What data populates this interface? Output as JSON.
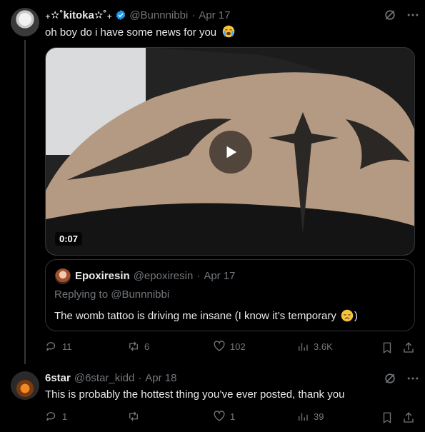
{
  "tweet1": {
    "display_name": "₊✫˚kitoka✫˚₊",
    "handle": "@Bunnnibbi",
    "separator": "·",
    "date": "Apr 17",
    "text": "oh boy do i have some news for you",
    "video": {
      "duration": "0:07"
    },
    "quote": {
      "display_name": "Epoxiresin",
      "handle": "@epoxiresin",
      "separator": "·",
      "date": "Apr 17",
      "replying_prefix": "Replying to",
      "replying_handle": "@Bunnnibbi",
      "text_before": "The womb tattoo is driving me insane (I know it’s temporary",
      "text_after": ")"
    },
    "stats": {
      "replies": "11",
      "reposts": "6",
      "likes": "102",
      "views": "3.6K"
    }
  },
  "tweet2": {
    "display_name": "6star",
    "handle": "@6star_kidd",
    "separator": "·",
    "date": "Apr 18",
    "text": "This is probably the hottest thing you’ve ever posted, thank you",
    "stats": {
      "replies": "1",
      "reposts": "",
      "likes": "1",
      "views": "39"
    }
  },
  "colors": {
    "background": "#000000",
    "text": "#e7e9ea",
    "muted": "#71767b",
    "verified": "#1d9bf0"
  },
  "icons": [
    "verified-badge-icon",
    "grok-icon",
    "more-icon",
    "reply-icon",
    "repost-icon",
    "like-icon",
    "views-icon",
    "bookmark-icon",
    "share-icon",
    "play-icon"
  ]
}
